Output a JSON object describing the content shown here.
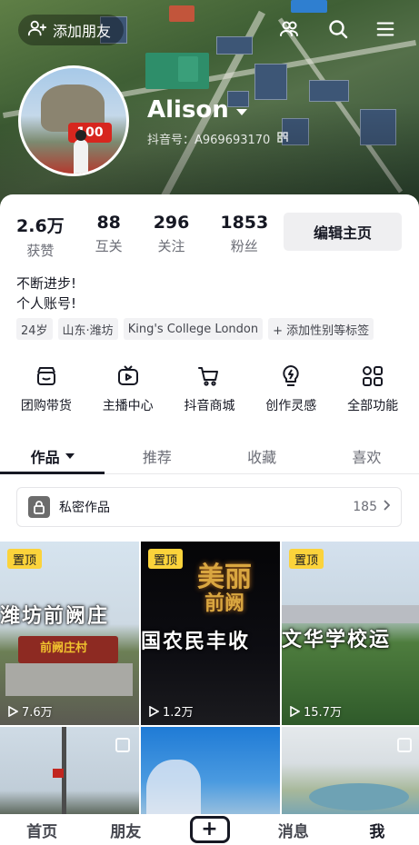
{
  "header": {
    "add_friend_label": "添加朋友",
    "icons": [
      "friends-icon",
      "search-icon",
      "menu-icon"
    ]
  },
  "profile": {
    "avatar_badge": "100",
    "nickname": "Alison",
    "account_id": "抖音号：A969693170"
  },
  "stats": [
    {
      "value": "2.6万",
      "label": "获赞"
    },
    {
      "value": "88",
      "label": "互关"
    },
    {
      "value": "296",
      "label": "关注"
    },
    {
      "value": "1853",
      "label": "粉丝"
    }
  ],
  "edit_button_label": "编辑主页",
  "bio": {
    "line1": "不断进步!",
    "line2": "个人账号!"
  },
  "tags": [
    {
      "label": "24岁"
    },
    {
      "label": "山东·潍坊"
    },
    {
      "label": "King's College London"
    },
    {
      "label": "+ 添加性别等标签"
    }
  ],
  "features": [
    {
      "label": "团购带货",
      "icon": "group-buy-icon"
    },
    {
      "label": "主播中心",
      "icon": "live-tv-icon"
    },
    {
      "label": "抖音商城",
      "icon": "shopping-cart-icon"
    },
    {
      "label": "创作灵感",
      "icon": "lightbulb-icon"
    },
    {
      "label": "全部功能",
      "icon": "grid-icon"
    }
  ],
  "tabs": [
    {
      "label": "作品",
      "active": true
    },
    {
      "label": "推荐"
    },
    {
      "label": "收藏"
    },
    {
      "label": "喜欢"
    }
  ],
  "private_works": {
    "label": "私密作品",
    "count": "185"
  },
  "videos": [
    {
      "pinned": "置顶",
      "caption": "潍坊前阙庄",
      "sign": "前阙庄村",
      "plays": "7.6万"
    },
    {
      "pinned": "置顶",
      "caption": "国农民丰收",
      "neon1": "美丽",
      "neon2": "前阙",
      "plays": "1.2万"
    },
    {
      "pinned": "置顶",
      "caption": "文华学校运",
      "plays": "15.7万"
    },
    {},
    {},
    {}
  ],
  "bottom_nav": {
    "home": "首页",
    "friends": "朋友",
    "plus": "+",
    "messages": "消息",
    "me": "我"
  },
  "colors": {
    "pin_badge": "#fbd33b",
    "text_primary": "#161823",
    "text_secondary": "#6b6d76"
  }
}
